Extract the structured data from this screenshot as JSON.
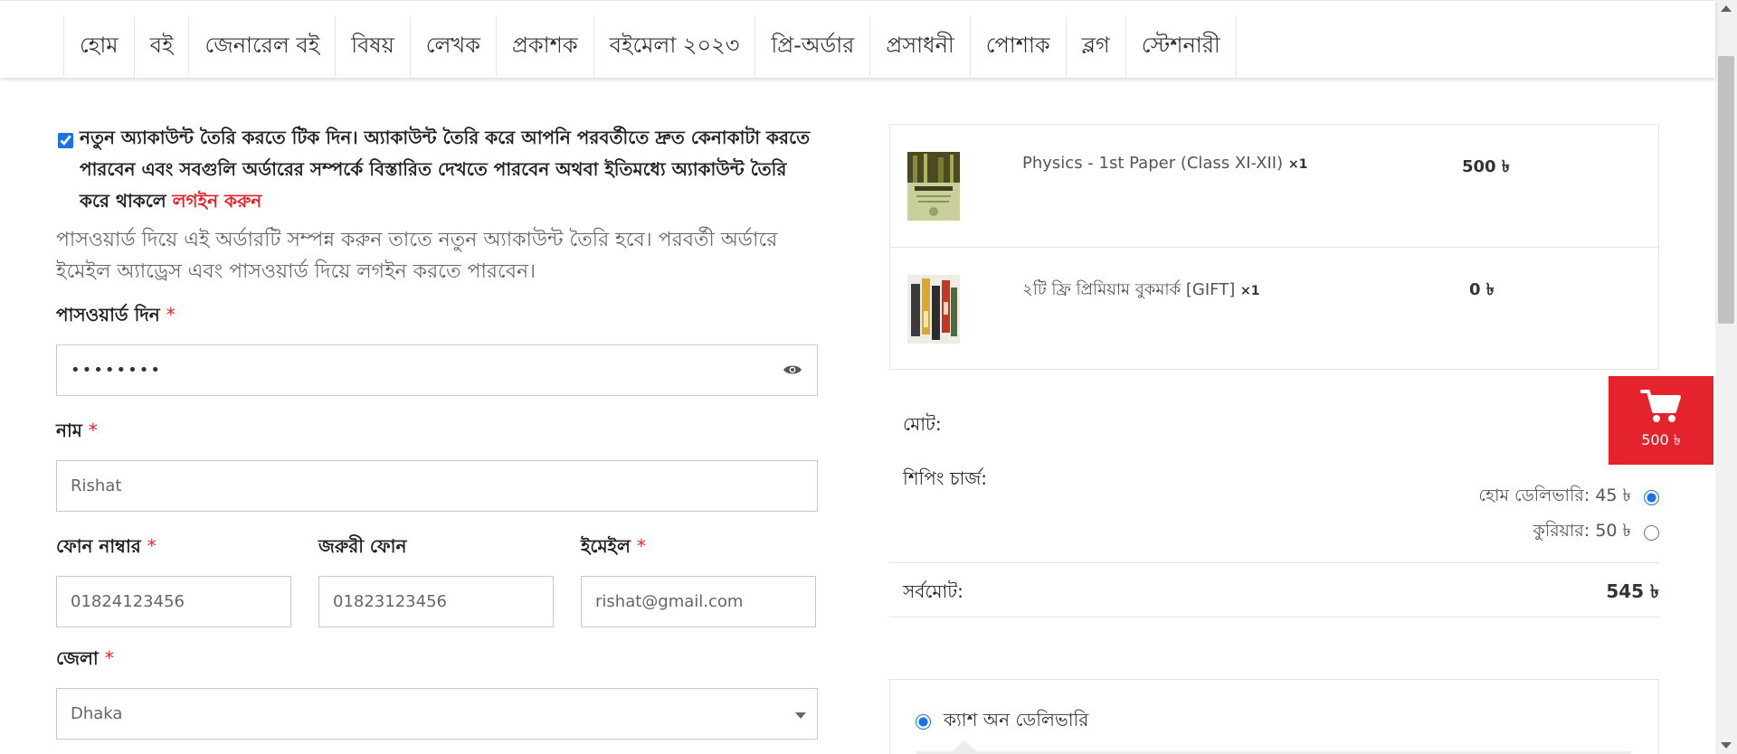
{
  "nav": {
    "items": [
      "হোম",
      "বই",
      "জেনারেল বই",
      "বিষয়",
      "লেখক",
      "প্রকাশক",
      "বইমেলা ২০২৩",
      "প্রি-অর্ডার",
      "প্রসাধনী",
      "পোশাক",
      "ব্লগ",
      "স্টেশনারী"
    ]
  },
  "account": {
    "create_text": "নতুন অ্যাকাউন্ট তৈরি করতে টিক দিন। অ্যাকাউন্ট তৈরি করে আপনি পরবর্তীতে দ্রুত কেনাকাটা করতে পারবেন এবং সবগুলি অর্ডারের সম্পর্কে বিস্তারিত দেখতে পারবেন অথবা ইতিমধ্যে অ্যাকাউন্ট তৈরি করে থাকলে",
    "login_link": "লগইন করুন",
    "helper": "পাসওয়ার্ড দিয়ে এই অর্ডারটি সম্পন্ন করুন তাতে নতুন অ্যাকাউন্ট তৈরি হবে। পরবর্তী অর্ডারে ইমেইল অ্যাড্রেস এবং পাসওয়ার্ড দিয়ে লগইন করতে পারবেন।",
    "checked": true
  },
  "form": {
    "password_label": "পাসওয়ার্ড দিন",
    "password_value": "••••••••",
    "name_label": "নাম",
    "name_value": "Rishat",
    "phone_label": "ফোন নাম্বার",
    "phone_value": "01824123456",
    "emergency_label": "জরুরী ফোন",
    "emergency_value": "01823123456",
    "email_label": "ইমেইল",
    "email_value": "rishat@gmail.com",
    "district_label": "জেলা",
    "district_value": "Dhaka",
    "required_mark": "*"
  },
  "order": {
    "items": [
      {
        "name": "Physics - 1st Paper (Class XI-XII)",
        "qty": "×1",
        "price": "500 ৳"
      },
      {
        "name": "২টি ফ্রি প্রিমিয়াম বুকমার্ক [GIFT]",
        "qty": "×1",
        "price": "0 ৳"
      }
    ],
    "subtotal_label": "মোট:",
    "shipping_label": "শিপিং চার্জ:",
    "shipping_options": [
      {
        "label": "হোম ডেলিভারি: 45 ৳",
        "selected": true
      },
      {
        "label": "কুরিয়ার: 50 ৳",
        "selected": false
      }
    ],
    "grand_total_label": "সর্বমোট:",
    "grand_total_value": "545 ৳"
  },
  "payment": {
    "option_label": "ক্যাশ অন ডেলিভারি",
    "selected": true
  },
  "cart_float": {
    "amount": "500 ৳"
  },
  "colors": {
    "accent_red": "#e5232c",
    "radio_blue": "#1a73e8"
  }
}
